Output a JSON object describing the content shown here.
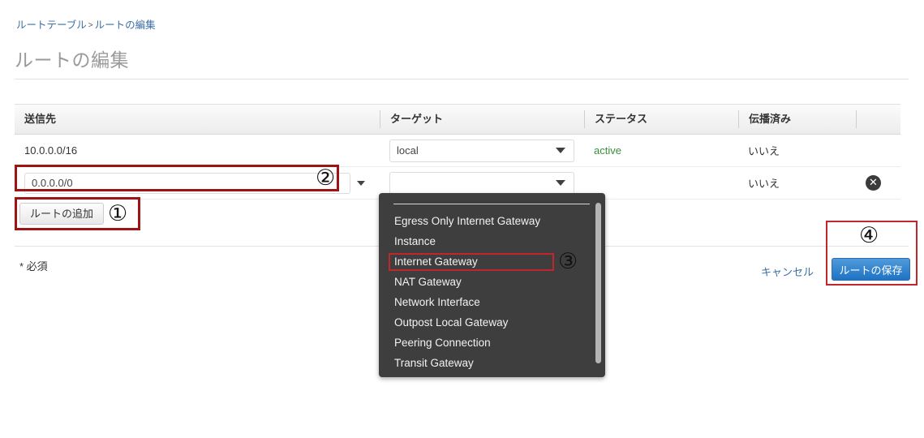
{
  "breadcrumb": {
    "parent": "ルートテーブル",
    "separator": ">",
    "current": "ルートの編集"
  },
  "page": {
    "title": "ルートの編集",
    "required_note": "* 必須"
  },
  "table": {
    "headers": {
      "destination": "送信先",
      "target": "ターゲット",
      "status": "ステータス",
      "propagated": "伝播済み",
      "actions": ""
    },
    "rows": [
      {
        "destination": "10.0.0.0/16",
        "target": "local",
        "status": "active",
        "propagated": "いいえ",
        "remove_icon": "✕"
      },
      {
        "destination": "0.0.0.0/0",
        "destination_placeholder": "",
        "target": "",
        "status": "",
        "propagated": "いいえ",
        "remove_icon": "✕"
      }
    ]
  },
  "buttons": {
    "add_route": "ルートの追加",
    "cancel": "キャンセル",
    "save": "ルートの保存"
  },
  "dropdown": {
    "options": [
      "Egress Only Internet Gateway",
      "Instance",
      "Internet Gateway",
      "NAT Gateway",
      "Network Interface",
      "Outpost Local Gateway",
      "Peering Connection",
      "Transit Gateway"
    ],
    "highlighted": "Internet Gateway"
  },
  "annotations": {
    "step1": "①",
    "step2": "②",
    "step3": "③",
    "step4": "④"
  },
  "colors": {
    "link": "#3b6ea5",
    "status_active": "#3a8f3c",
    "annotation_red": "#9e1414",
    "save_button_blue": "#1e73c4",
    "dropdown_bg": "#3e3e3e"
  }
}
